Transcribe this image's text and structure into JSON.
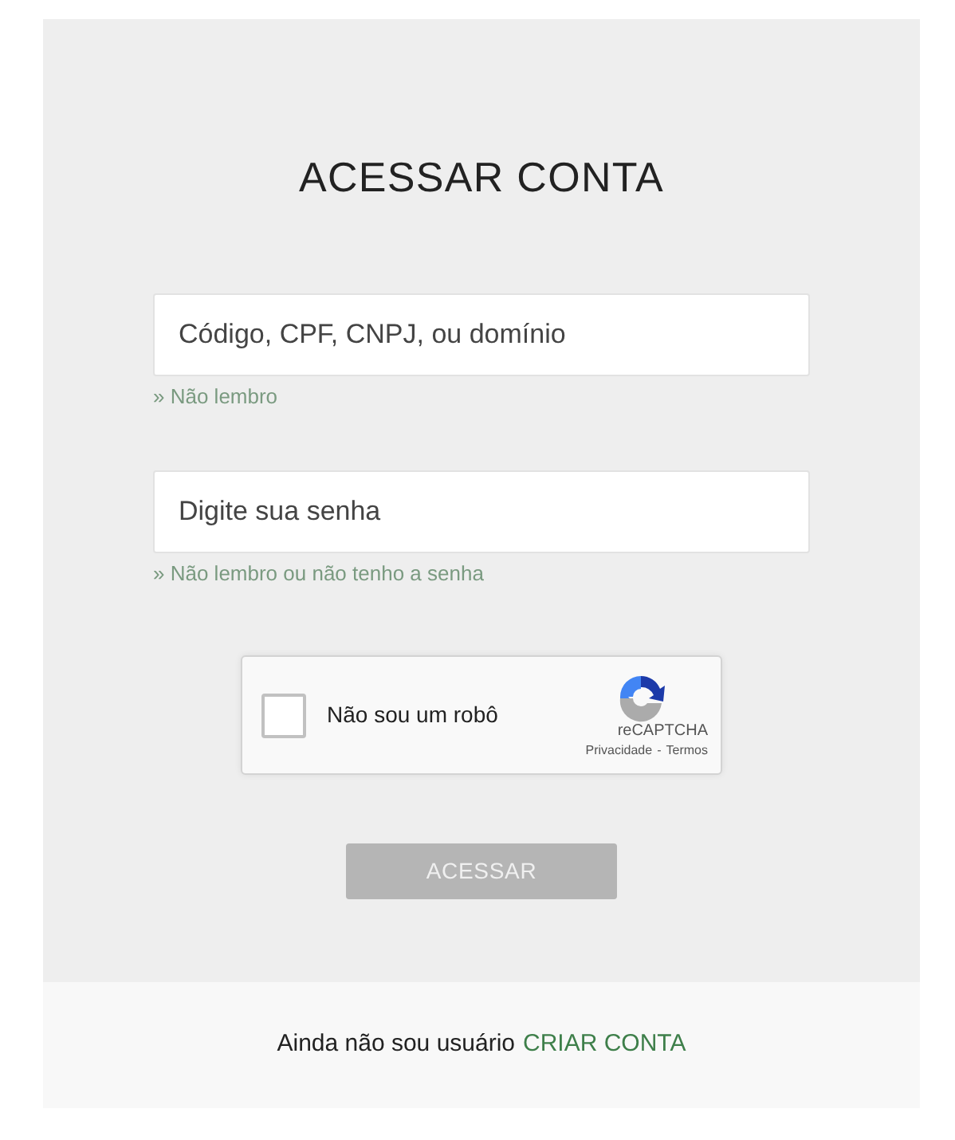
{
  "title": "ACESSAR CONTA",
  "fields": [
    {
      "placeholder": "Código, CPF, CNPJ, ou domínio",
      "help_link": "» Não lembro"
    },
    {
      "placeholder": "Digite sua senha",
      "help_link": "» Não lembro ou não tenho a senha"
    }
  ],
  "captcha": {
    "label": "Não sou um robô",
    "checked": false,
    "brand": "reCAPTCHA",
    "privacy": "Privacidade",
    "separator": "-",
    "terms": "Termos"
  },
  "submit": {
    "label": "ACESSAR",
    "disabled": true
  },
  "footer": {
    "text": "Ainda não sou usuário",
    "link": "CRIAR CONTA"
  }
}
